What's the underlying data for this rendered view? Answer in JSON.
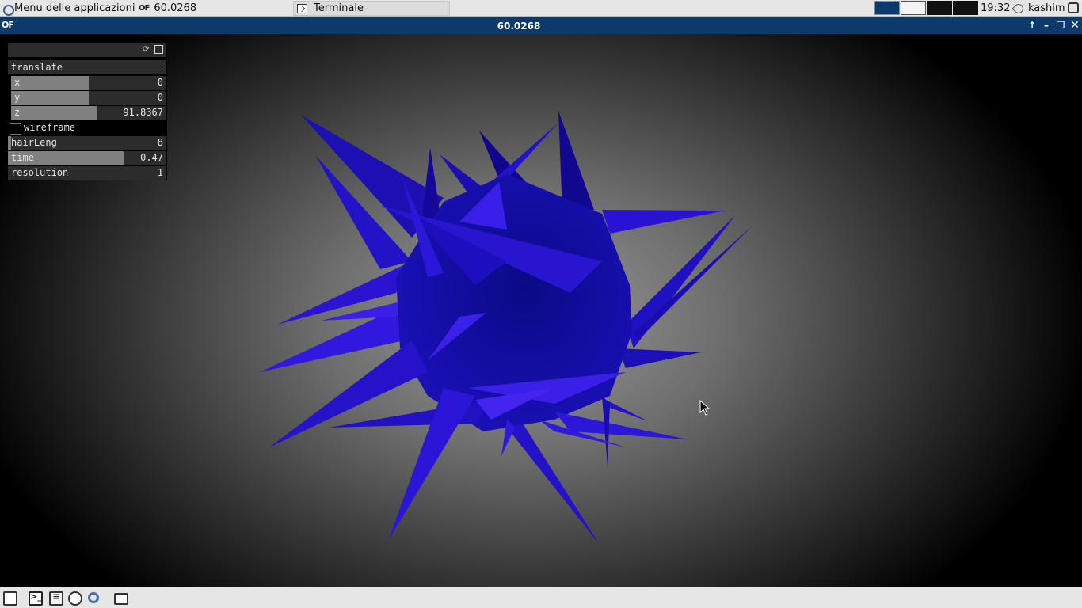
{
  "top_panel": {
    "apps_menu_label": "Menu delle applicazioni",
    "tasks": [
      {
        "label": "60.0268",
        "icon": "openframeworks-icon"
      },
      {
        "label": "Terminale",
        "icon": "terminal-icon"
      }
    ],
    "clock": "19:32",
    "user": "kashim"
  },
  "window": {
    "title": "60.0268",
    "logo": "OF"
  },
  "gui": {
    "group_label": "translate",
    "group_collapse": "-",
    "x": {
      "label": "x",
      "value": "0",
      "fraction": 0.5
    },
    "y": {
      "label": "y",
      "value": "0",
      "fraction": 0.5
    },
    "z": {
      "label": "z",
      "value": "91.8367",
      "fraction": 0.55
    },
    "wireframe": {
      "label": "wireframe",
      "checked": false
    },
    "hairLeng": {
      "label": "hairLeng",
      "value": "8",
      "fraction": 0.02
    },
    "time": {
      "label": "time",
      "value": "0.47",
      "fraction": 0.73
    },
    "resolution": {
      "label": "resolution",
      "value": "1",
      "fraction": 0.0
    }
  },
  "colors": {
    "accent_blue": "#0b3a6b",
    "mesh_blue": "#2a12d4",
    "mesh_dark": "#0a0a8c"
  }
}
